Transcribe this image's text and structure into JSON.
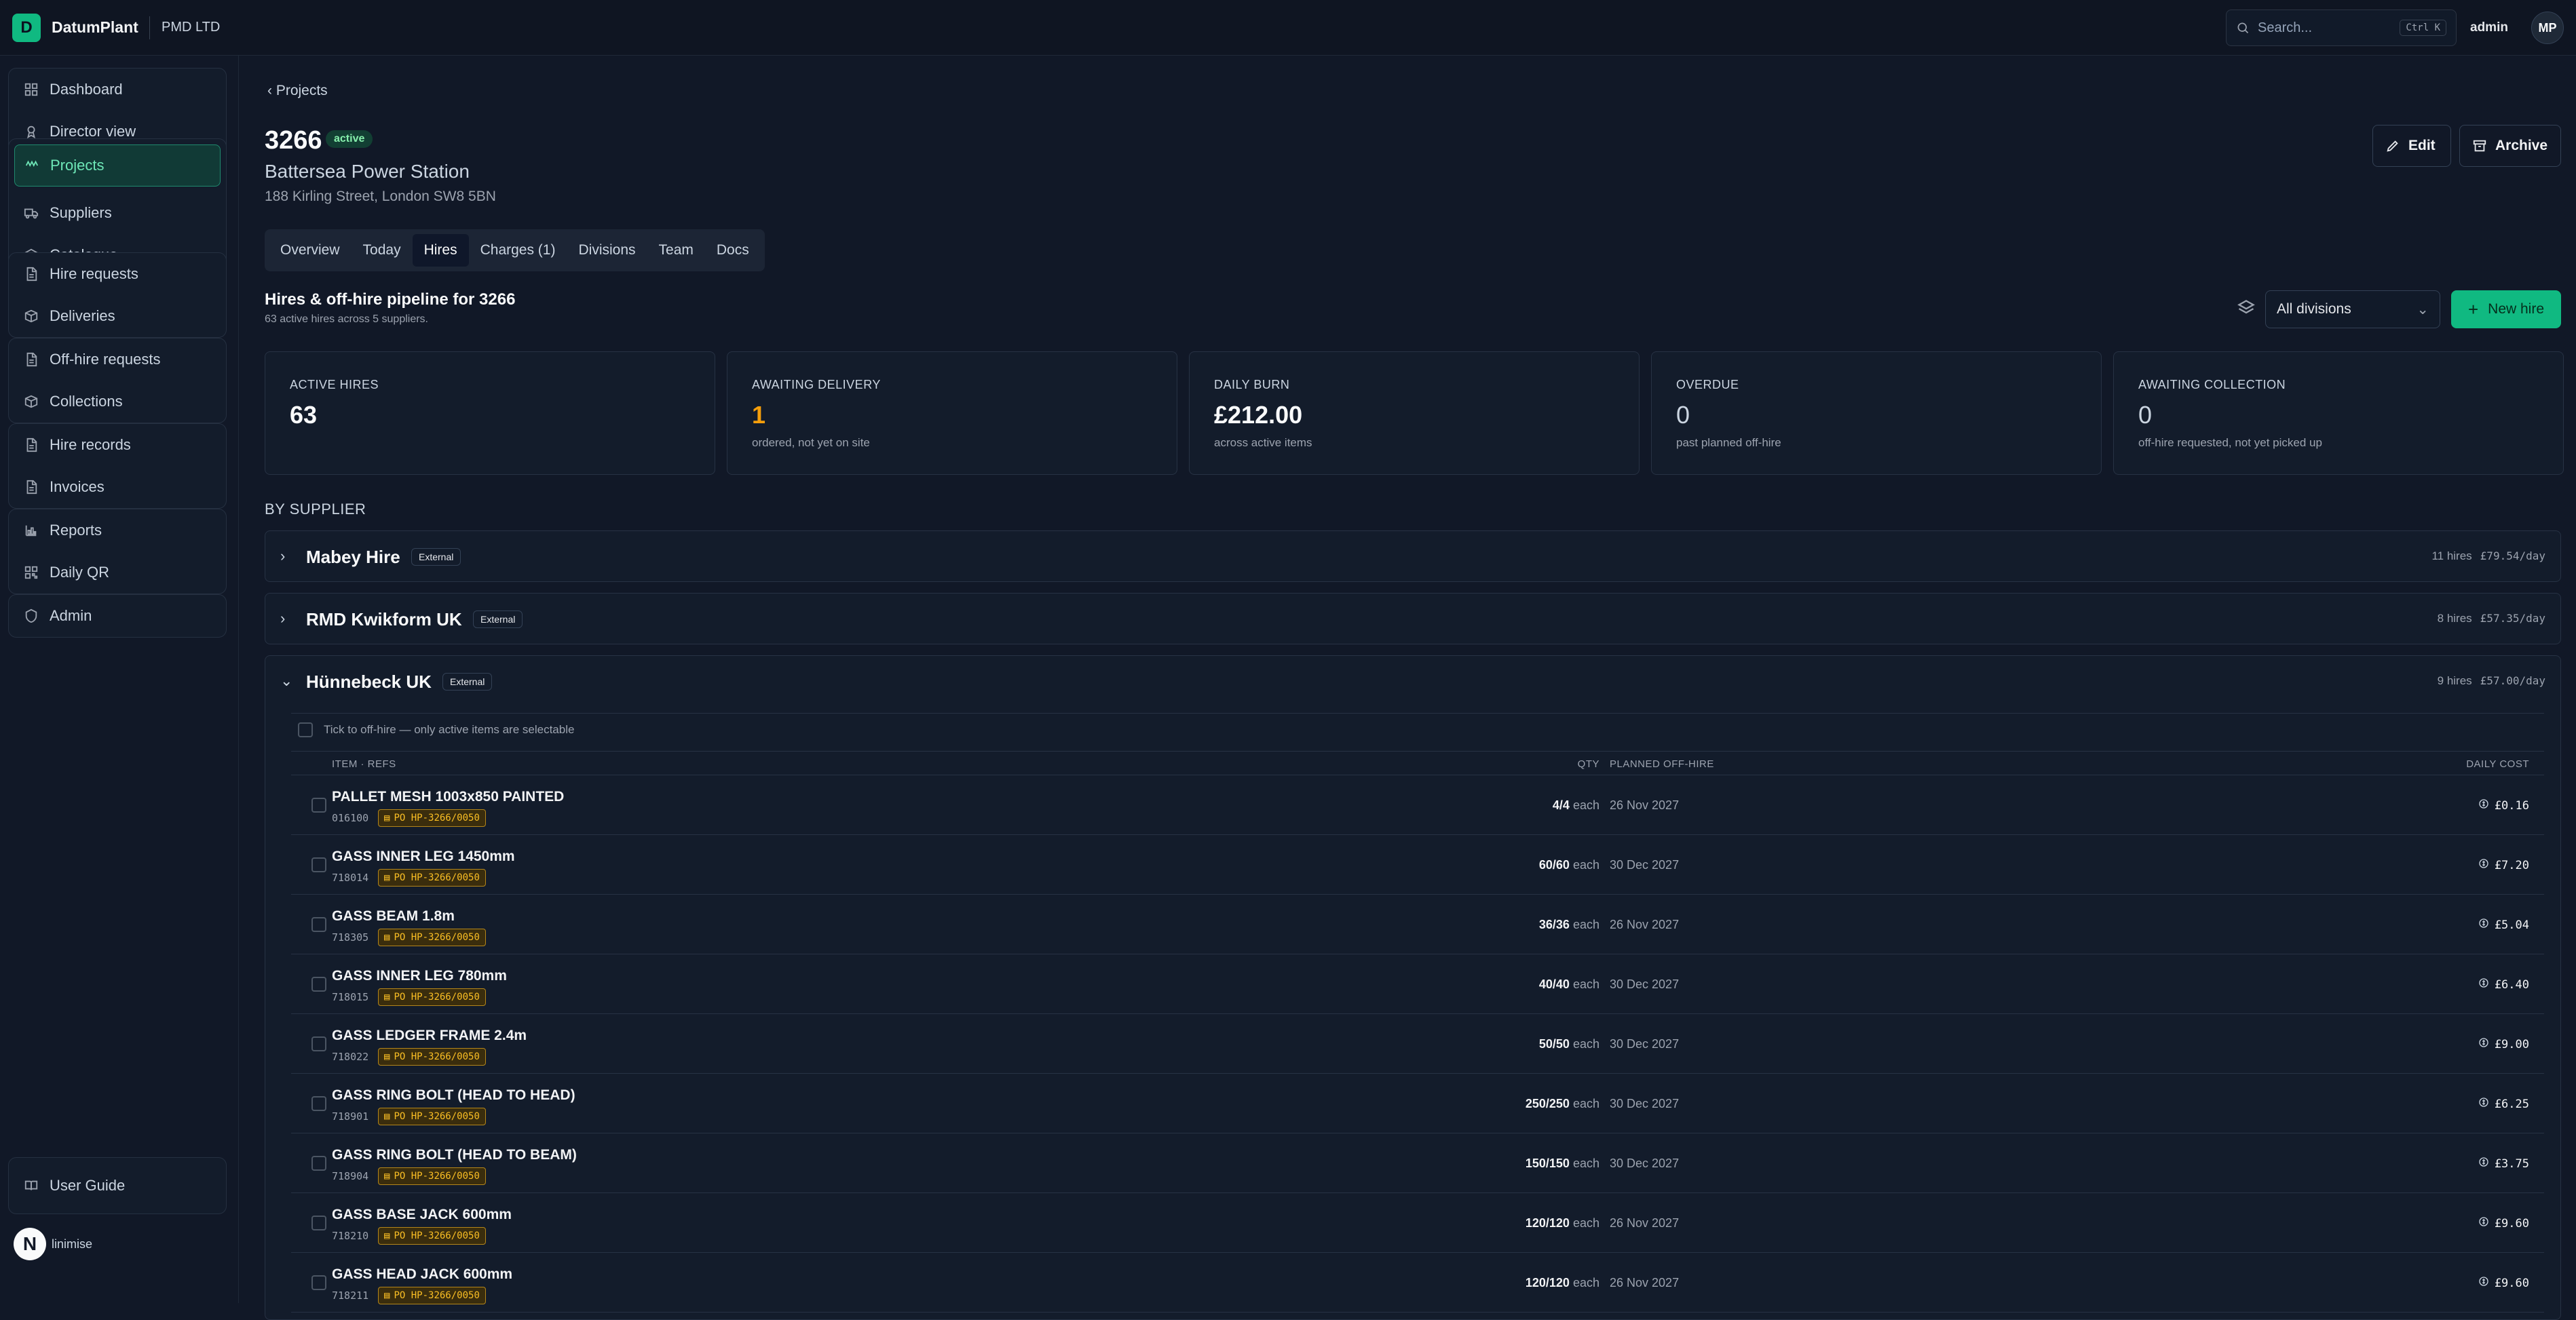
{
  "topbar": {
    "logo_letter": "D",
    "brand": "DatumPlant",
    "org": "PMD LTD",
    "search_placeholder": "Search...",
    "search_shortcut": "Ctrl K",
    "admin_label": "admin",
    "avatar_initials": "MP"
  },
  "sidebar": {
    "groups": [
      [
        {
          "label": "Dashboard",
          "icon": "grid-icon"
        },
        {
          "label": "Director view",
          "icon": "award-icon"
        }
      ],
      [
        {
          "label": "Projects",
          "icon": "projects-icon",
          "active": true
        },
        {
          "label": "Suppliers",
          "icon": "truck-icon"
        },
        {
          "label": "Catalogue",
          "icon": "layers-icon"
        }
      ],
      [
        {
          "label": "Hire requests",
          "icon": "file-icon"
        },
        {
          "label": "Deliveries",
          "icon": "package-icon"
        }
      ],
      [
        {
          "label": "Off-hire requests",
          "icon": "file-icon"
        },
        {
          "label": "Collections",
          "icon": "package-icon"
        }
      ],
      [
        {
          "label": "Hire records",
          "icon": "file-icon"
        },
        {
          "label": "Invoices",
          "icon": "file-icon"
        }
      ],
      [
        {
          "label": "Reports",
          "icon": "chart-icon"
        },
        {
          "label": "Daily QR",
          "icon": "qr-icon"
        }
      ],
      [
        {
          "label": "Admin",
          "icon": "shield-icon"
        }
      ]
    ],
    "user_guide": "User Guide",
    "footer_badge": "N",
    "footer_label": "linimise"
  },
  "project": {
    "breadcrumb": "Projects",
    "code": "3266",
    "status": "active",
    "name": "Battersea Power Station",
    "address": "188 Kirling Street, London SW8 5BN",
    "edit_label": "Edit",
    "archive_label": "Archive"
  },
  "tabs": [
    "Overview",
    "Today",
    "Hires",
    "Charges (1)",
    "Divisions",
    "Team",
    "Docs"
  ],
  "active_tab": "Hires",
  "section": {
    "title": "Hires & off-hire pipeline for 3266",
    "subtitle": "63 active hires across 5 suppliers.",
    "division_select": "All divisions",
    "new_hire_label": "New hire"
  },
  "stats": [
    {
      "label": "ACTIVE HIRES",
      "value": "63",
      "caption": "",
      "style": "normal"
    },
    {
      "label": "AWAITING DELIVERY",
      "value": "1",
      "caption": "ordered, not yet on site",
      "style": "warn"
    },
    {
      "label": "DAILY BURN",
      "value": "£212.00",
      "caption": "across active items",
      "style": "normal"
    },
    {
      "label": "OVERDUE",
      "value": "0",
      "caption": "past planned off-hire",
      "style": "muted"
    },
    {
      "label": "AWAITING COLLECTION",
      "value": "0",
      "caption": "off-hire requested, not yet picked up",
      "style": "muted"
    }
  ],
  "by_supplier_label": "BY SUPPLIER",
  "suppliers": [
    {
      "name": "Mabey Hire",
      "tag": "External",
      "hires": "11 hires",
      "cost": "£79.54/day",
      "expanded": false
    },
    {
      "name": "RMD Kwikform UK",
      "tag": "External",
      "hires": "8 hires",
      "cost": "£57.35/day",
      "expanded": false
    },
    {
      "name": "Hünnebeck UK",
      "tag": "External",
      "hires": "9 hires",
      "cost": "£57.00/day",
      "expanded": true
    }
  ],
  "table": {
    "tick_label": "Tick to off-hire — only active items are selectable",
    "headers": {
      "item": "ITEM · REFS",
      "qty": "QTY",
      "planned": "PLANNED OFF-HIRE",
      "cost": "DAILY COST"
    },
    "unit": "each",
    "rows": [
      {
        "name": "PALLET MESH 1003x850 PAINTED",
        "code": "016100",
        "po": "PO HP-3266/0050",
        "qty": "4/4",
        "date": "26 Nov 2027",
        "cost": "£0.16"
      },
      {
        "name": "GASS INNER LEG 1450mm",
        "code": "718014",
        "po": "PO HP-3266/0050",
        "qty": "60/60",
        "date": "30 Dec 2027",
        "cost": "£7.20"
      },
      {
        "name": "GASS BEAM 1.8m",
        "code": "718305",
        "po": "PO HP-3266/0050",
        "qty": "36/36",
        "date": "26 Nov 2027",
        "cost": "£5.04"
      },
      {
        "name": "GASS INNER LEG 780mm",
        "code": "718015",
        "po": "PO HP-3266/0050",
        "qty": "40/40",
        "date": "30 Dec 2027",
        "cost": "£6.40"
      },
      {
        "name": "GASS LEDGER FRAME 2.4m",
        "code": "718022",
        "po": "PO HP-3266/0050",
        "qty": "50/50",
        "date": "30 Dec 2027",
        "cost": "£9.00"
      },
      {
        "name": "GASS RING BOLT (HEAD TO HEAD)",
        "code": "718901",
        "po": "PO HP-3266/0050",
        "qty": "250/250",
        "date": "30 Dec 2027",
        "cost": "£6.25"
      },
      {
        "name": "GASS RING BOLT (HEAD TO BEAM)",
        "code": "718904",
        "po": "PO HP-3266/0050",
        "qty": "150/150",
        "date": "30 Dec 2027",
        "cost": "£3.75"
      },
      {
        "name": "GASS BASE JACK 600mm",
        "code": "718210",
        "po": "PO HP-3266/0050",
        "qty": "120/120",
        "date": "26 Nov 2027",
        "cost": "£9.60"
      },
      {
        "name": "GASS HEAD JACK 600mm",
        "code": "718211",
        "po": "PO HP-3266/0050",
        "qty": "120/120",
        "date": "26 Nov 2027",
        "cost": "£9.60"
      }
    ]
  }
}
